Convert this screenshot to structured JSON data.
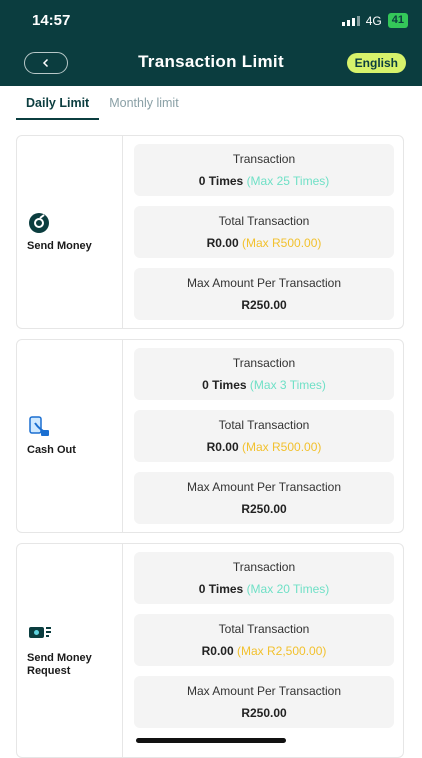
{
  "status": {
    "time": "14:57",
    "network": "4G",
    "battery": "41"
  },
  "header": {
    "title": "Transaction Limit",
    "language_label": "English",
    "back_icon": "chevron-left-icon"
  },
  "tabs": [
    {
      "label": "Daily Limit",
      "active": true
    },
    {
      "label": "Monthly limit",
      "active": false
    }
  ],
  "cards": [
    {
      "label": "Send Money",
      "icon": "send-money-icon",
      "transaction_label": "Transaction",
      "transaction_count": "0 Times",
      "transaction_max": "(Max 25 Times)",
      "total_label": "Total Transaction",
      "total_value": "R0.00",
      "total_max": "(Max R500.00)",
      "per_tx_label": "Max Amount Per Transaction",
      "per_tx_value": "R250.00"
    },
    {
      "label": "Cash Out",
      "icon": "cash-out-icon",
      "transaction_label": "Transaction",
      "transaction_count": "0 Times",
      "transaction_max": "(Max 3 Times)",
      "total_label": "Total Transaction",
      "total_value": "R0.00",
      "total_max": "(Max R500.00)",
      "per_tx_label": "Max Amount Per Transaction",
      "per_tx_value": "R250.00"
    },
    {
      "label": "Send Money Request",
      "label_line1": "Send Money",
      "label_line2": "Request",
      "icon": "money-request-icon",
      "transaction_label": "Transaction",
      "transaction_count": "0 Times",
      "transaction_max": "(Max 20 Times)",
      "total_label": "Total Transaction",
      "total_value": "R0.00",
      "total_max": "(Max R2,500.00)",
      "per_tx_label": "Max Amount Per Transaction",
      "per_tx_value": "R250.00"
    }
  ],
  "colors": {
    "header_bg": "#0b3d3f",
    "accent": "#d7f26b",
    "teal": "#6fe0c6",
    "gold": "#f2c12e"
  }
}
